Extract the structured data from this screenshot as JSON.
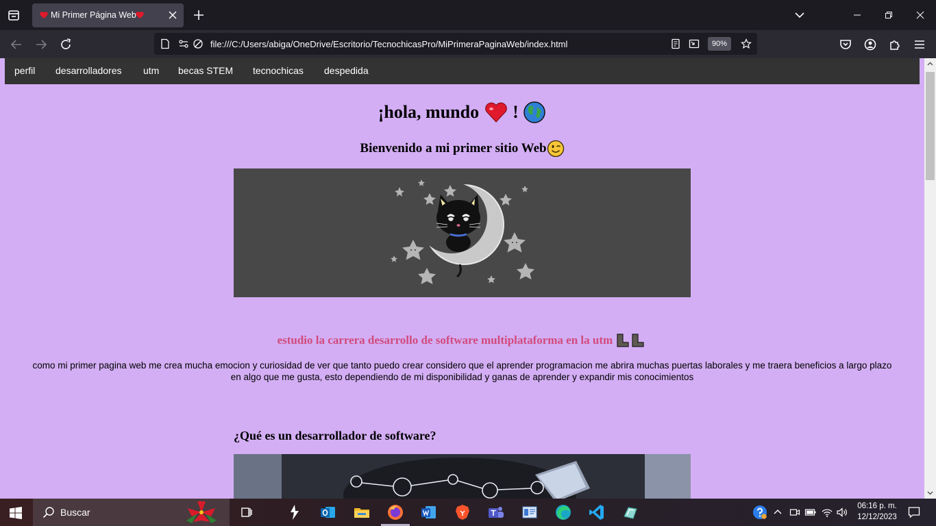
{
  "browser": {
    "tab_title": "Mi Primer Página Web",
    "url": "file:///C:/Users/abiga/OneDrive/Escritorio/TecnochicasPro/MiPrimeraPaginaWeb/index.html",
    "zoom": "90%"
  },
  "page": {
    "menu": [
      "perfil",
      "desarrolladores",
      "utm",
      "becas STEM",
      "tecnochicas",
      "despedida"
    ],
    "heading": "¡hola, mundo",
    "heading_exclaim": "!",
    "welcome": "Bienvenido a mi primer sitio Web",
    "career": "estudio la carrera desarrollo de software multiplataforma en la utm",
    "paragraph": "como mi primer pagina web me crea mucha emocion y curiosidad de ver que tanto puedo crear considero que el aprender programacion me abrira muchas puertas laborales y me traera beneficios a largo plazo en algo que me gusta, esto dependiendo de mi disponibilidad y ganas de aprender y expandir mis conocimientos",
    "question": "¿Qué es un desarrollador de software?",
    "colors": {
      "background": "#d3aef4",
      "menu_bg": "#333333",
      "career_text": "#d24a7c"
    }
  },
  "taskbar": {
    "search_placeholder": "Buscar",
    "time": "06:16 p. m.",
    "date": "12/12/2023"
  },
  "icons": {
    "heading_emojis": [
      "heart-icon",
      "globe-icon"
    ],
    "welcome_emoji": "wink-face-icon",
    "career_emojis": [
      "boot-icon",
      "boot-icon"
    ]
  }
}
